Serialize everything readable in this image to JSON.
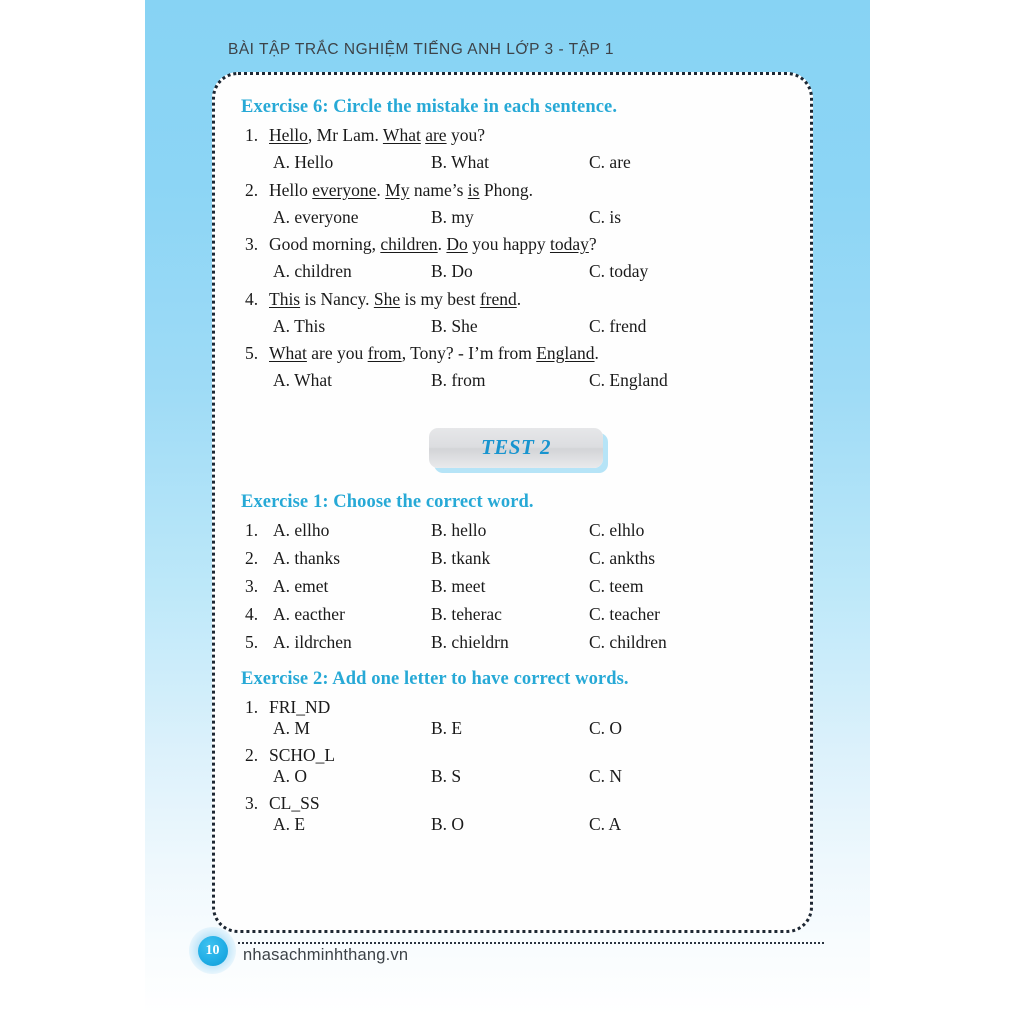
{
  "header": {
    "running_head": "BÀI TẬP TRẮC NGHIỆM TIẾNG ANH LỚP 3 - TẬP 1"
  },
  "colors": {
    "accent_blue": "#27a9d6",
    "band_blue": "#87d3f4",
    "badge_blue": "#1894cf",
    "text_dark": "#1a1a1a",
    "head_gray": "#3d4348"
  },
  "exercise6": {
    "heading": "Exercise 6: Circle the mistake in each sentence.",
    "questions": [
      {
        "num": "1.",
        "parts": [
          {
            "t": "Hello",
            "u": true
          },
          {
            "t": ", Mr Lam. ",
            "u": false
          },
          {
            "t": "What",
            "u": true
          },
          {
            "t": " ",
            "u": false
          },
          {
            "t": "are",
            "u": true
          },
          {
            "t": " you?",
            "u": false
          }
        ],
        "options": [
          "A. Hello",
          "B. What",
          "C. are"
        ]
      },
      {
        "num": "2.",
        "parts": [
          {
            "t": "Hello ",
            "u": false
          },
          {
            "t": "everyone",
            "u": true
          },
          {
            "t": ". ",
            "u": false
          },
          {
            "t": "My",
            "u": true
          },
          {
            "t": " name’s ",
            "u": false
          },
          {
            "t": "is",
            "u": true
          },
          {
            "t": " Phong.",
            "u": false
          }
        ],
        "options": [
          "A. everyone",
          "B. my",
          "C. is"
        ]
      },
      {
        "num": "3.",
        "parts": [
          {
            "t": "Good morning, ",
            "u": false
          },
          {
            "t": "children",
            "u": true
          },
          {
            "t": ". ",
            "u": false
          },
          {
            "t": "Do",
            "u": true
          },
          {
            "t": " you happy ",
            "u": false
          },
          {
            "t": "today",
            "u": true
          },
          {
            "t": "?",
            "u": false
          }
        ],
        "options": [
          "A. children",
          "B. Do",
          "C. today"
        ]
      },
      {
        "num": "4.",
        "parts": [
          {
            "t": "This",
            "u": true
          },
          {
            "t": " is Nancy. ",
            "u": false
          },
          {
            "t": "She",
            "u": true
          },
          {
            "t": " is my best ",
            "u": false
          },
          {
            "t": "frend",
            "u": true
          },
          {
            "t": ".",
            "u": false
          }
        ],
        "options": [
          "A. This",
          "B. She",
          "C. frend"
        ]
      },
      {
        "num": "5.",
        "parts": [
          {
            "t": "What",
            "u": true
          },
          {
            "t": " are you ",
            "u": false
          },
          {
            "t": "from",
            "u": true
          },
          {
            "t": ", Tony? - I’m from ",
            "u": false
          },
          {
            "t": "England",
            "u": true
          },
          {
            "t": ".",
            "u": false
          }
        ],
        "options": [
          "A. What",
          "B. from",
          "C. England"
        ]
      }
    ]
  },
  "test_badge": {
    "label": "TEST 2"
  },
  "exercise1": {
    "heading": "Exercise 1: Choose the correct word.",
    "rows": [
      {
        "num": "1.",
        "options": [
          "A. ellho",
          "B. hello",
          "C. elhlo"
        ]
      },
      {
        "num": "2.",
        "options": [
          "A. thanks",
          "B. tkank",
          "C. ankths"
        ]
      },
      {
        "num": "3.",
        "options": [
          "A. emet",
          "B. meet",
          "C. teem"
        ]
      },
      {
        "num": "4.",
        "options": [
          "A. eacther",
          "B. teherac",
          "C. teacher"
        ]
      },
      {
        "num": "5.",
        "options": [
          "A. ildrchen",
          "B. chieldrn",
          "C. children"
        ]
      }
    ]
  },
  "exercise2": {
    "heading": "Exercise 2: Add one letter to have correct words.",
    "items": [
      {
        "num": "1.",
        "word": "FRI_ND",
        "options": [
          "A. M",
          "B. E",
          "C. O"
        ]
      },
      {
        "num": "2.",
        "word": "SCHO_L",
        "options": [
          "A. O",
          "B. S",
          "C. N"
        ]
      },
      {
        "num": "3.",
        "word": "CL_SS",
        "options": [
          "A. E",
          "B. O",
          "C. A"
        ]
      }
    ]
  },
  "footer": {
    "page_number": "10",
    "site": "nhasachminhthang.vn"
  }
}
